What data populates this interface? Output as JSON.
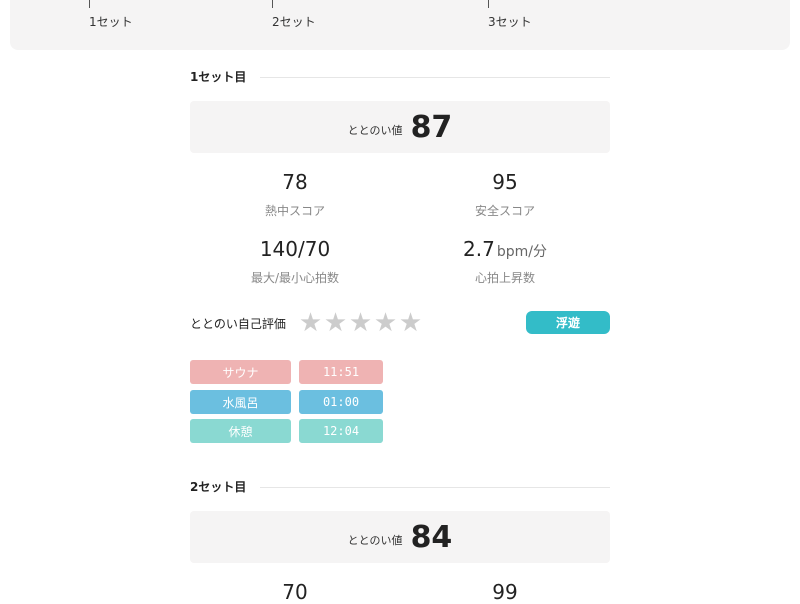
{
  "timeline": {
    "labels": [
      "1セット",
      "2セット",
      "3セット"
    ]
  },
  "sets": [
    {
      "title": "1セット目",
      "totonoi_label": "ととのい値",
      "totonoi_value": "87",
      "heat_score": "78",
      "heat_label": "熱中スコア",
      "safety_score": "95",
      "safety_label": "安全スコア",
      "hr_range": "140/70",
      "hr_range_label": "最大/最小心拍数",
      "hr_rise": "2.7",
      "hr_rise_unit": "bpm/分",
      "hr_rise_label": "心拍上昇数",
      "rating_label": "ととのい自己評価",
      "stars": "★★★★★",
      "rating_value": 0,
      "badge": "浮遊",
      "phases": [
        {
          "name": "サウナ",
          "time": "11:51",
          "color": "#efb3b3"
        },
        {
          "name": "水風呂",
          "time": "01:00",
          "color": "#6bbfe0"
        },
        {
          "name": "休憩",
          "time": "12:04",
          "color": "#8ad9d2"
        }
      ]
    },
    {
      "title": "2セット目",
      "totonoi_label": "ととのい値",
      "totonoi_value": "84",
      "heat_score": "70",
      "safety_score": "99"
    }
  ],
  "colors": {
    "accent": "#33bcc8",
    "sauna": "#efb3b3",
    "water": "#6bbfe0",
    "rest": "#8ad9d2",
    "star_empty": "#cccccc"
  }
}
